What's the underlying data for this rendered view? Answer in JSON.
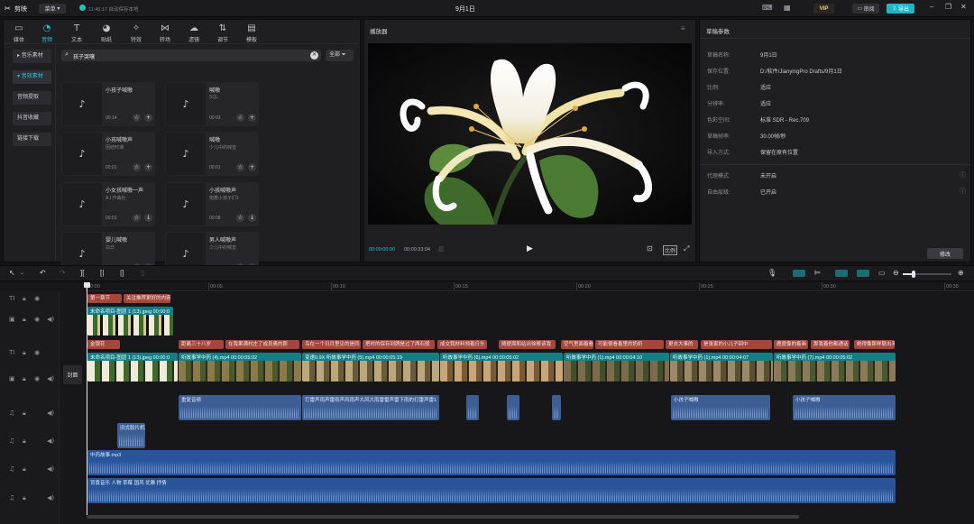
{
  "titlebar": {
    "app_name": "剪映",
    "menu_label": "菜单",
    "autosave": "11:46:17 自动保存本地",
    "project_title": "9月1日",
    "vip_label": "VIP",
    "review_label": "审阅",
    "export_label": "导出"
  },
  "media_tabs": [
    {
      "label": "媒体",
      "icon": "media-icon"
    },
    {
      "label": "音频",
      "icon": "audio-icon"
    },
    {
      "label": "文本",
      "icon": "text-icon"
    },
    {
      "label": "贴纸",
      "icon": "sticker-icon"
    },
    {
      "label": "特效",
      "icon": "effects-icon"
    },
    {
      "label": "转场",
      "icon": "transition-icon"
    },
    {
      "label": "滤镜",
      "icon": "filter-icon"
    },
    {
      "label": "调节",
      "icon": "adjust-icon"
    },
    {
      "label": "模板",
      "icon": "template-icon"
    }
  ],
  "audio_sidebar": [
    {
      "label": "音乐素材"
    },
    {
      "label": "音效素材"
    },
    {
      "label": "音频提取"
    },
    {
      "label": "抖音收藏"
    },
    {
      "label": "链接下载"
    }
  ],
  "search": {
    "value": "孩子哭嚷",
    "filter_label": "全部"
  },
  "sound_cards": [
    {
      "title": "小孩子喊嗷",
      "subtitle": "",
      "duration": "00:14"
    },
    {
      "title": "喊嗷",
      "subtitle": "SQL",
      "duration": "00:03"
    },
    {
      "title": "小孩喊嗷声",
      "subtitle": "团结时课",
      "duration": "00:01"
    },
    {
      "title": "喊嗷",
      "subtitle": "少儿中的喊音",
      "duration": "00:01"
    },
    {
      "title": "小女孩喊嗷一声",
      "subtitle": "A.I.作曲社",
      "duration": "00:01"
    },
    {
      "title": "小孩喊嗷声",
      "subtitle": "抱着小孩子们1",
      "duration": "00:08"
    },
    {
      "title": "婴儿喊嗷",
      "subtitle": "白日",
      "duration": "00:01"
    },
    {
      "title": "男人喊嗷声",
      "subtitle": "少儿中的喊音",
      "duration": "00:01"
    }
  ],
  "player": {
    "title": "播放器",
    "current_time": "00:00:00:00",
    "total_time": "00:00:33:04"
  },
  "draft": {
    "title": "草稿参数",
    "rows": [
      {
        "label": "草稿名称:",
        "value": "9月1日"
      },
      {
        "label": "保存位置:",
        "value": "D:/软件/JianyingPro Drafts/9月1日"
      },
      {
        "label": "比例:",
        "value": "适应"
      },
      {
        "label": "分辨率:",
        "value": "适应"
      },
      {
        "label": "色彩空间:",
        "value": "标准 SDR - Rec.709"
      },
      {
        "label": "草稿帧率:",
        "value": "30.00帧/秒"
      },
      {
        "label": "导入方式:",
        "value": "保留在原有位置"
      }
    ],
    "rows2": [
      {
        "label": "代理模式:",
        "value": "未开启"
      },
      {
        "label": "自由层级:",
        "value": "已开启"
      }
    ],
    "modify_label": "修改"
  },
  "timeline": {
    "ruler": [
      "00:00",
      "00:05",
      "00:10",
      "00:15",
      "00:20",
      "00:25",
      "00:30",
      "00:35"
    ],
    "cover_label": "封面",
    "text_row1": [
      "第一章节",
      "关注推荐更好的内容"
    ],
    "video_row1": "未命名项目-图层 1 (13).jpeg  00:00:0",
    "text_row2": [
      "金银花",
      "距离三十八岁",
      "在我果满村庄了成员奥的那",
      "鸟在一个日月里见的是同",
      "把时的保存到牌是过了两石般",
      "成交我材料领着日头",
      "随便周和站出徐察该我",
      "空气里面着看的",
      "可能很看着里的奶奶",
      "更去大事的",
      "是张家的小儿子回中",
      "鹿度像的着画",
      "那我着他都通话",
      "她得像那样联出来"
    ],
    "video_row2": [
      {
        "label": "未命名项目-图层 1 (13).jpeg  00:00:0"
      },
      {
        "label": "听故事学中药 (4).mp4  00:00:05:02"
      },
      {
        "label": "变速0.9X  听故事学中药 (5).mp4  00:00:05:19"
      },
      {
        "label": "听故事学中药 (6).mp4  00:00:05:02"
      },
      {
        "label": "听故事学中药 (1).mp4  00:00:04:10"
      },
      {
        "label": "听故事学中药 (1).mp4  00:00:04:07"
      },
      {
        "label": "听故事学中药 (7).mp4  00:00:05:02"
      }
    ],
    "audio_row1": [
      "重复音频",
      "打雷声雨声雷雨声风雨声大风大雨雷雷声雷下雨的打雷声雷1",
      "小孩子喊嗷",
      "小孩子喊嗷"
    ],
    "audio_row2": "旧式胶片机",
    "music_row1": "中药故事.mp3",
    "music_row2": "背景音乐 人物 草莓 国风 优雅 抒情"
  }
}
